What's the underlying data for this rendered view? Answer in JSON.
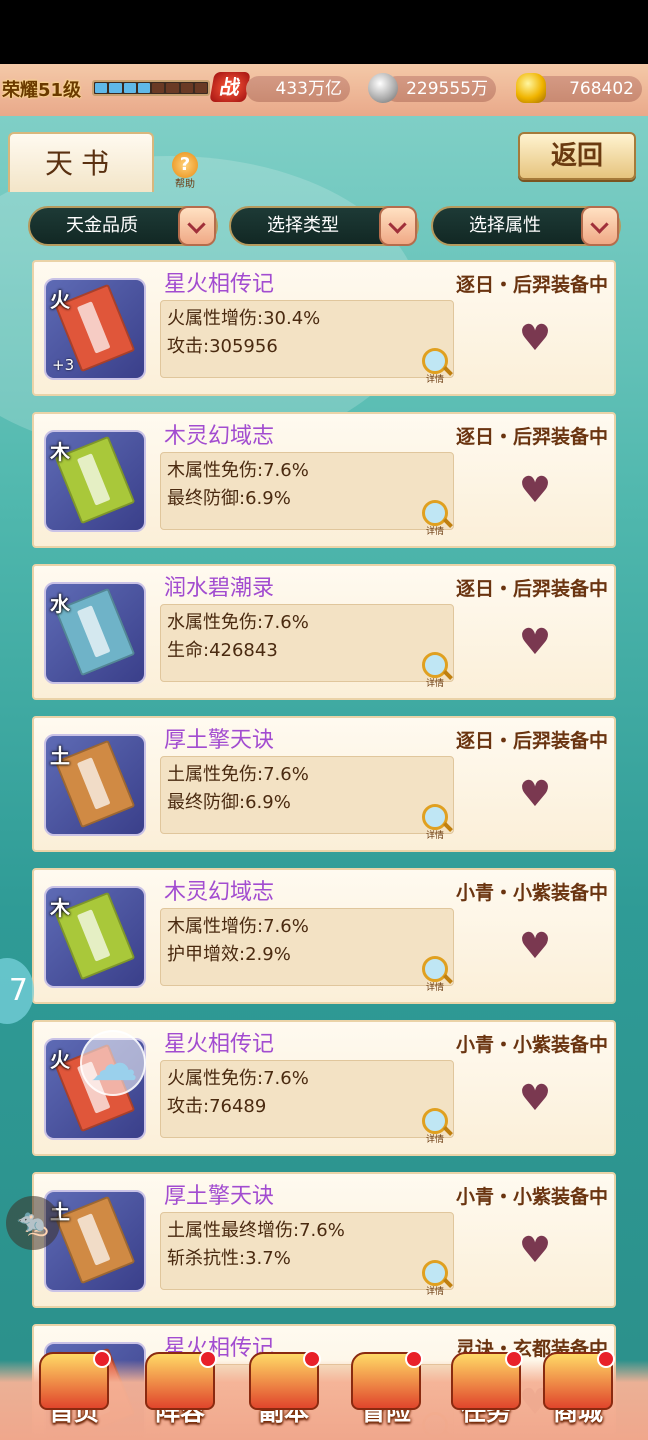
{
  "status_bar": {
    "level_text": "荣耀51级",
    "exp_segments_filled": 4,
    "exp_segments_total": 8,
    "power_icon_text": "战",
    "power_value": "433万亿",
    "silver_value": "229555万",
    "gold_value": "768402"
  },
  "header": {
    "title": "天书",
    "help_label": "帮助",
    "back_label": "返回"
  },
  "filters": [
    {
      "label": "天金品质"
    },
    {
      "label": "选择类型"
    },
    {
      "label": "选择属性"
    }
  ],
  "detail_label": "详情",
  "cards": [
    {
      "element": "火",
      "plus": "+3",
      "name": "星火相传记",
      "equip": "逐日・后羿装备中",
      "stat1": "火属性增伤:30.4%",
      "stat2": "攻击:305956",
      "color": "#e0563a"
    },
    {
      "element": "木",
      "plus": "",
      "name": "木灵幻域志",
      "equip": "逐日・后羿装备中",
      "stat1": "木属性免伤:7.6%",
      "stat2": "最终防御:6.9%",
      "color": "#a9c83a"
    },
    {
      "element": "水",
      "plus": "",
      "name": "润水碧潮录",
      "equip": "逐日・后羿装备中",
      "stat1": "水属性免伤:7.6%",
      "stat2": "生命:426843",
      "color": "#6fb3c8"
    },
    {
      "element": "土",
      "plus": "",
      "name": "厚土擎天诀",
      "equip": "逐日・后羿装备中",
      "stat1": "土属性免伤:7.6%",
      "stat2": "最终防御:6.9%",
      "color": "#d08a44"
    },
    {
      "element": "木",
      "plus": "",
      "name": "木灵幻域志",
      "equip": "小青・小紫装备中",
      "stat1": "木属性增伤:7.6%",
      "stat2": "护甲增效:2.9%",
      "color": "#a9c83a"
    },
    {
      "element": "火",
      "plus": "",
      "name": "星火相传记",
      "equip": "小青・小紫装备中",
      "stat1": "火属性免伤:7.6%",
      "stat2": "攻击:76489",
      "color": "#e0563a"
    },
    {
      "element": "土",
      "plus": "",
      "name": "厚土擎天诀",
      "equip": "小青・小紫装备中",
      "stat1": "土属性最终增伤:7.6%",
      "stat2": "斩杀抗性:3.7%",
      "color": "#d08a44"
    },
    {
      "element": "火",
      "plus": "",
      "name": "星火相传记",
      "equip": "灵诀・玄都装备中",
      "stat1": "",
      "stat2": "",
      "color": "#e0563a"
    }
  ],
  "side": {
    "bubble_text": "7"
  },
  "nav": [
    {
      "label": "首页"
    },
    {
      "label": "阵容"
    },
    {
      "label": "副本"
    },
    {
      "label": "冒险"
    },
    {
      "label": "任务"
    },
    {
      "label": "商城"
    }
  ]
}
